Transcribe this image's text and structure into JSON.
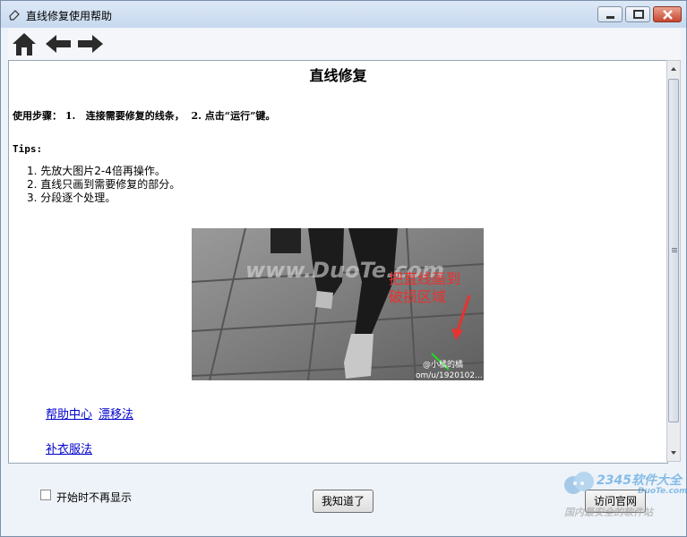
{
  "window": {
    "title": "直线修复使用帮助"
  },
  "toolbar": {
    "icons": [
      "home-icon",
      "back-arrow-icon",
      "forward-arrow-icon"
    ]
  },
  "content": {
    "heading": "直线修复",
    "steps": "使用步骤： 1.   连接需要修复的线条，  2. 点击“运行”键。",
    "tips_label": "Tips:",
    "tips": [
      "1. 先放大图片2-4倍再操作。",
      "2. 直线只画到需要修复的部分。",
      "3. 分段逐个处理。"
    ],
    "image": {
      "watermark_text": "www.DuoTe.com",
      "annotation": [
        "把直线画到",
        "破损区域"
      ],
      "credit": "@小橘的橘",
      "credit2": "om/u/1920102..."
    },
    "links": [
      "帮助中心",
      "漂移法",
      "补衣服法"
    ]
  },
  "footer": {
    "checkbox_label": "开始时不再显示",
    "ok_button": "我知道了",
    "visit_button": "访问官网"
  },
  "brand_watermark": {
    "text": "2345软件大全",
    "sub": "DuoTe.com",
    "footer_text": "国内最安全的软件站"
  },
  "colors": {
    "link": "#0000cc",
    "annotation": "#e8322e",
    "close": "#c8462f"
  }
}
